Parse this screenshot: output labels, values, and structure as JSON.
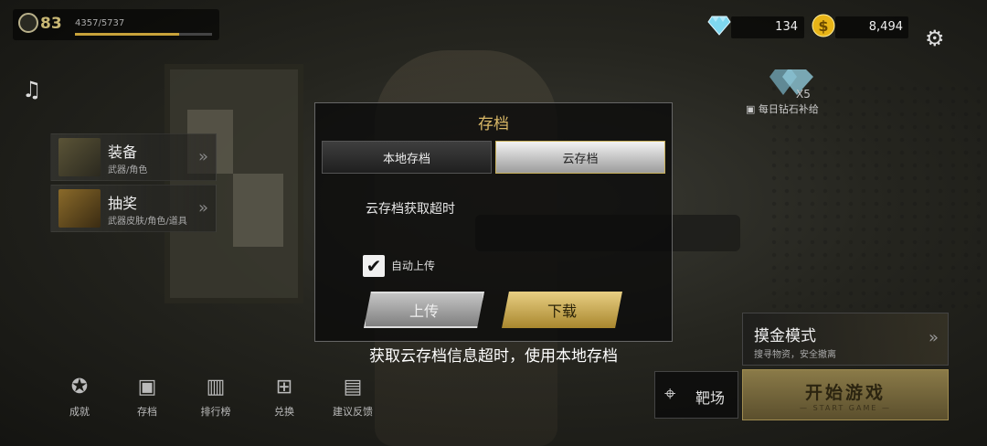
{
  "player": {
    "level": "83",
    "xp": "4357/5737",
    "xp_fraction": 0.759
  },
  "currency": {
    "diamonds": "134",
    "gold": "8,494"
  },
  "daily_reward": {
    "multiplier": "X5",
    "label": "每日钻石补给"
  },
  "menu": [
    {
      "title": "装备",
      "subtitle": "武器/角色"
    },
    {
      "title": "抽奖",
      "subtitle": "武器皮肤/角色/道具"
    }
  ],
  "dialog": {
    "title": "存档",
    "tabs": [
      "本地存档",
      "云存档"
    ],
    "active_tab": "云存档",
    "message": "云存档获取超时",
    "auto_upload_label": "自动上传",
    "auto_upload_checked": true,
    "upload_label": "上传",
    "download_label": "下载"
  },
  "toast": "获取云存档信息超时，使用本地存档",
  "bottom_nav": [
    {
      "label": "成就",
      "icon": "medal-icon"
    },
    {
      "label": "存档",
      "icon": "save-icon"
    },
    {
      "label": "排行榜",
      "icon": "leaderboard-icon"
    },
    {
      "label": "兑换",
      "icon": "gift-icon"
    },
    {
      "label": "建议反馈",
      "icon": "chat-icon"
    }
  ],
  "range": {
    "label": "靶场"
  },
  "mode": {
    "title": "摸金模式",
    "subtitle": "搜寻物资，安全撤离"
  },
  "start": {
    "title": "开始游戏",
    "subtitle": "START GAME"
  },
  "colors": {
    "accent_gold": "#d9b867",
    "diamond": "#7fd8f0",
    "coin": "#e8b417"
  }
}
